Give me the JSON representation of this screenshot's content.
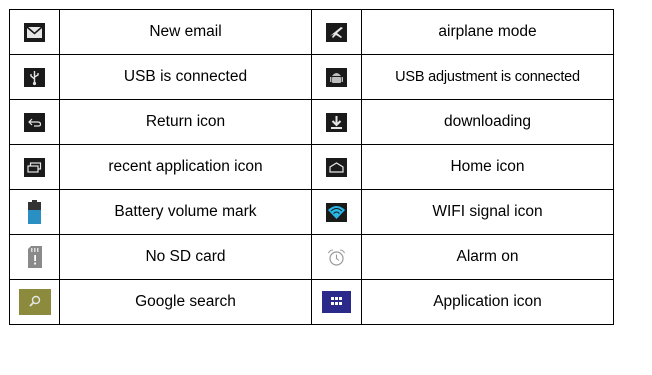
{
  "rows": [
    {
      "left": {
        "icon": "envelope-icon",
        "label": "New email"
      },
      "right": {
        "icon": "airplane-icon",
        "label": "airplane mode"
      }
    },
    {
      "left": {
        "icon": "usb-icon",
        "label": "USB is connected"
      },
      "right": {
        "icon": "android-debug-icon",
        "label": "USB adjustment is connected"
      }
    },
    {
      "left": {
        "icon": "return-arrow-icon",
        "label": "Return icon"
      },
      "right": {
        "icon": "download-icon",
        "label": "downloading"
      }
    },
    {
      "left": {
        "icon": "recent-apps-icon",
        "label": "recent application icon"
      },
      "right": {
        "icon": "home-icon",
        "label": "Home icon"
      }
    },
    {
      "left": {
        "icon": "battery-icon",
        "label": "Battery volume mark"
      },
      "right": {
        "icon": "wifi-icon",
        "label": "WIFI signal icon"
      }
    },
    {
      "left": {
        "icon": "no-sd-card-icon",
        "label": "No SD card"
      },
      "right": {
        "icon": "alarm-clock-icon",
        "label": "Alarm on"
      }
    },
    {
      "left": {
        "icon": "google-search-icon",
        "label": "Google search"
      },
      "right": {
        "icon": "app-grid-icon",
        "label": "Application icon"
      }
    }
  ],
  "colors": {
    "icon_dark": "#1a1a1a",
    "icon_light": "#e6e6e6",
    "wifi_blue": "#29b6e8",
    "battery_blue": "#2a8fc2",
    "google_bg": "#8c8a3c",
    "app_grid_bg": "#2b2a8a"
  }
}
